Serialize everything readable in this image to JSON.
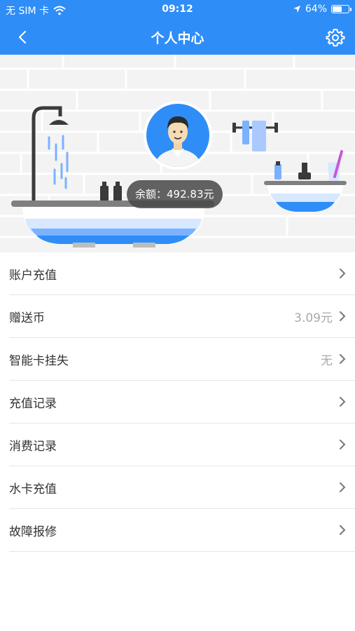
{
  "status_bar": {
    "carrier": "无 SIM 卡",
    "time": "09:12",
    "battery": "64%",
    "battery_level": 0.64
  },
  "nav": {
    "title": "个人中心",
    "back_icon": "chevron-left-icon",
    "settings_icon": "gear-icon"
  },
  "profile": {
    "balance": "余额：492.83元"
  },
  "menu": [
    {
      "label": "账户充值",
      "value": ""
    },
    {
      "label": "赠送币",
      "value": "3.09元"
    },
    {
      "label": "智能卡挂失",
      "value": "无"
    },
    {
      "label": "充值记录",
      "value": ""
    },
    {
      "label": "消费记录",
      "value": ""
    },
    {
      "label": "水卡充值",
      "value": ""
    },
    {
      "label": "故障报修",
      "value": ""
    }
  ],
  "colors": {
    "primary": "#2f8df7",
    "text": "#333333",
    "muted": "#aaaaaa"
  }
}
